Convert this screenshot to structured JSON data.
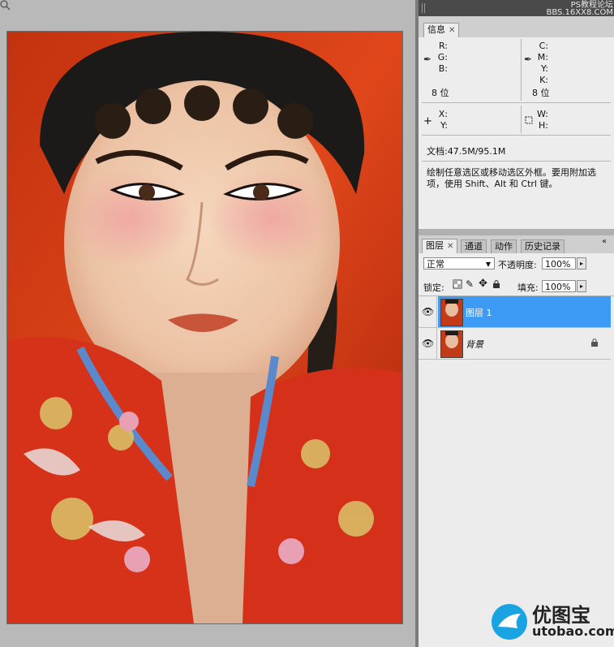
{
  "info_panel": {
    "tab_label": "信息",
    "color_labels_left": [
      "R:",
      "G:",
      "B:"
    ],
    "color_labels_right": [
      "C:",
      "M:",
      "Y:",
      "K:"
    ],
    "bit_depth_left": "8 位",
    "bit_depth_right": "8 位",
    "coord_labels": [
      "X:",
      "Y:"
    ],
    "size_labels": [
      "W:",
      "H:"
    ],
    "doc_size": "文档:47.5M/95.1M",
    "hint_text": "绘制任意选区或移动选区外框。要用附加选项，使用 Shift、Alt 和 Ctrl 键。"
  },
  "header_watermark": {
    "line1": "PS教程论坛",
    "line2": "BBS.16XX8.COM"
  },
  "layers_panel": {
    "tabs": [
      "图层",
      "通道",
      "动作",
      "历史记录"
    ],
    "blend_mode": "正常",
    "opacity_label": "不透明度:",
    "opacity_value": "100%",
    "lock_label": "锁定:",
    "fill_label": "填充:",
    "fill_value": "100%",
    "layers": [
      {
        "name": "图层 1",
        "selected": true
      },
      {
        "name": "背景",
        "selected": false,
        "locked": true
      }
    ]
  },
  "footer_watermark": {
    "brand": "优图宝",
    "domain": "utobao.com"
  },
  "colors": {
    "selected_layer": "#3d9bf5",
    "brand_blue": "#1aa3e3"
  }
}
